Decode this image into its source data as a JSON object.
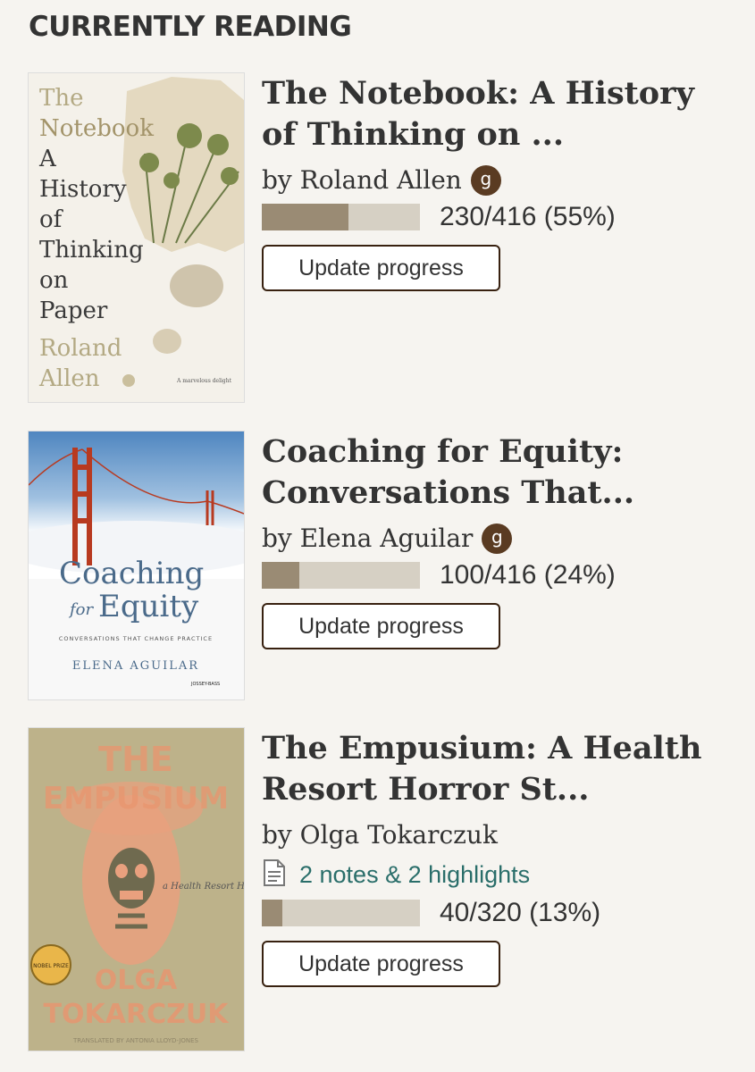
{
  "section": {
    "title": "CURRENTLY READING"
  },
  "books": [
    {
      "title": "The Notebook: A History of Thinking on ...",
      "author": "by Roland Allen",
      "badge": "g",
      "progress_text": "230/416 (55%)",
      "progress_fraction": 0.55,
      "update_label": "Update progress",
      "cover": {
        "lines": [
          "The",
          "Notebook",
          "A",
          "History",
          "of",
          "Thinking",
          "on",
          "Paper",
          "Roland",
          "Allen"
        ],
        "blurb": "A marvelous delight"
      }
    },
    {
      "title": "Coaching for Equity: Conversations That...",
      "author": "by Elena Aguilar",
      "badge": "g",
      "progress_text": "100/416 (24%)",
      "progress_fraction": 0.24,
      "update_label": "Update progress",
      "cover": {
        "title1": "Coaching",
        "title2a": "for",
        "title2b": "Equity",
        "subtitle": "CONVERSATIONS THAT CHANGE PRACTICE",
        "author": "ELENA AGUILAR",
        "publisher": "JOSSEY-BASS"
      }
    },
    {
      "title": "The Empusium: A Health Resort Horror St...",
      "author": "by Olga Tokarczuk",
      "notes_label": "2 notes & 2 highlights",
      "progress_text": "40/320 (13%)",
      "progress_fraction": 0.13,
      "update_label": "Update progress",
      "cover": {
        "title1": "THE",
        "title2": "EMPUSIUM",
        "tagline": "a Health Resort Horror Story",
        "badge": "NOBEL PRIZE",
        "author1": "OLGA",
        "author2": "TOKARCZUK",
        "translator": "TRANSLATED BY ANTONIA LLOYD-JONES"
      }
    }
  ],
  "colors": {
    "accent": "#382110",
    "bar_fill": "#9a8b74",
    "bar_bg": "#d6d0c4",
    "link": "#2a6e6a"
  }
}
